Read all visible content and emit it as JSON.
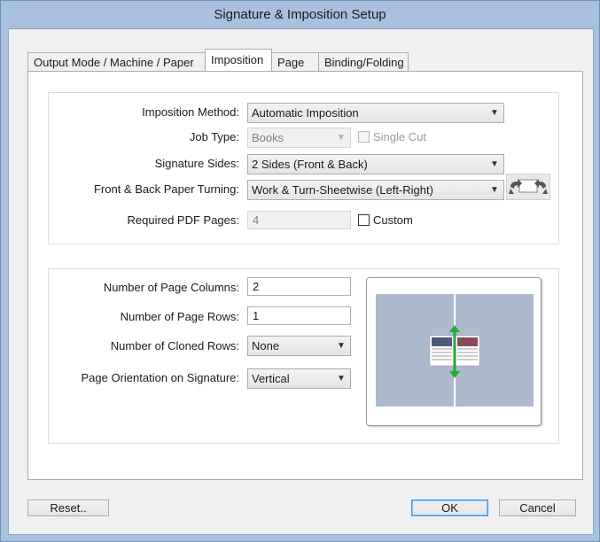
{
  "window": {
    "title": "Signature & Imposition Setup"
  },
  "tabs": [
    {
      "label": "Output Mode / Machine / Paper"
    },
    {
      "label": "Imposition"
    },
    {
      "label": "Page"
    },
    {
      "label": "Binding/Folding"
    }
  ],
  "imposition": {
    "method_label": "Imposition Method:",
    "method_value": "Automatic Imposition",
    "job_type_label": "Job Type:",
    "job_type_value": "Books",
    "single_cut_label": "Single Cut",
    "signature_sides_label": "Signature Sides:",
    "signature_sides_value": "2 Sides (Front & Back)",
    "paper_turning_label": "Front & Back Paper Turning:",
    "paper_turning_value": "Work & Turn-Sheetwise (Left-Right)",
    "required_pages_label": "Required PDF Pages:",
    "required_pages_value": "4",
    "custom_label": "Custom"
  },
  "layout": {
    "columns_label": "Number of Page Columns:",
    "columns_value": "2",
    "rows_label": "Number of Page Rows:",
    "rows_value": "1",
    "cloned_rows_label": "Number of Cloned Rows:",
    "cloned_rows_value": "None",
    "orientation_label": "Page Orientation on Signature:",
    "orientation_value": "Vertical"
  },
  "buttons": {
    "reset": "Reset..",
    "ok": "OK",
    "cancel": "Cancel"
  },
  "colors": {
    "sheet": "#adb9cd",
    "arrow": "#1faa3a",
    "default_border": "#3399ff"
  }
}
